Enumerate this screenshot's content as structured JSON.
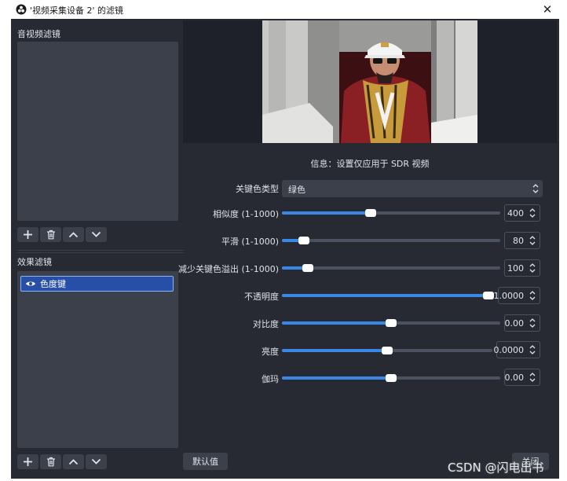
{
  "titlebar": {
    "title": "'视频采集设备 2' 的滤镜",
    "close": "✕"
  },
  "audio_video_filters": {
    "label": "音视频滤镜"
  },
  "effect_filters": {
    "label": "效果滤镜",
    "items": [
      {
        "label": "色度键",
        "visible": true,
        "selected": true
      }
    ]
  },
  "info_text": "信息：设置仅应用于 SDR 视频",
  "properties": {
    "key_color_type": {
      "label": "关键色类型",
      "value": "绿色"
    },
    "similarity": {
      "label": "相似度 (1-1000)",
      "value": "400",
      "fraction": 0.4
    },
    "smoothness": {
      "label": "平滑 (1-1000)",
      "value": "80",
      "fraction": 0.08
    },
    "spill": {
      "label": "减少关键色溢出 (1-1000)",
      "value": "100",
      "fraction": 0.1
    },
    "opacity": {
      "label": "不透明度",
      "value": "1.0000",
      "fraction": 1.0
    },
    "contrast": {
      "label": "对比度",
      "value": "0.00",
      "fraction": 0.5
    },
    "brightness": {
      "label": "亮度",
      "value": "0.0000",
      "fraction": 0.5
    },
    "gamma": {
      "label": "伽玛",
      "value": "0.00",
      "fraction": 0.5
    }
  },
  "buttons": {
    "defaults": "默认值",
    "close": "关闭"
  },
  "watermark": "CSDN @闪电出书",
  "colors": {
    "accent": "#3a88e6",
    "selection": "#284fa8",
    "panel": "#3c404b",
    "background": "#272a33"
  }
}
